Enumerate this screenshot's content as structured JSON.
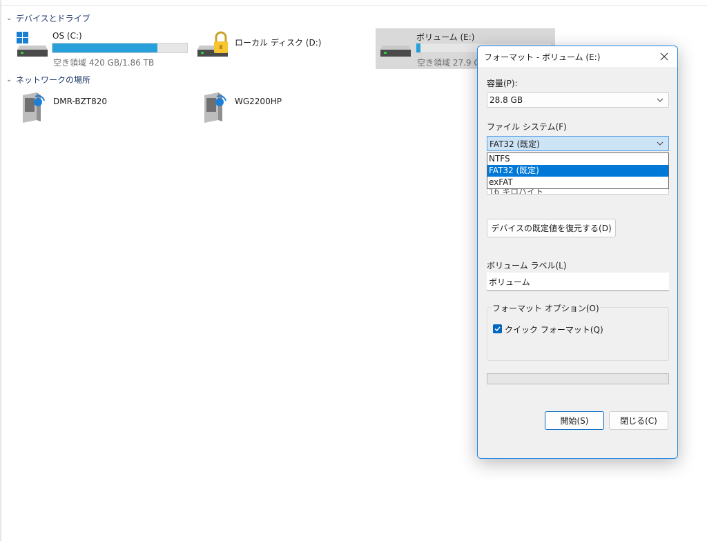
{
  "explorer": {
    "devices_section": "デバイスとドライブ",
    "network_section": "ネットワークの場所",
    "drives": [
      {
        "name": "OS (C:)",
        "free_text": "空き領域 420 GB/1.86 TB",
        "used_fraction": 0.78,
        "icon": "windows-drive-icon"
      },
      {
        "name": "ローカル ディスク (D:)",
        "icon": "locked-drive-icon"
      },
      {
        "name": "ボリューム (E:)",
        "free_text": "空き領域 27.9 G",
        "used_fraction": 0.03,
        "icon": "usb-drive-icon"
      }
    ],
    "network": [
      {
        "name": "DMR-BZT820",
        "icon": "network-device-icon"
      },
      {
        "name": "WG2200HP",
        "icon": "network-device-icon"
      }
    ]
  },
  "dialog": {
    "title": "フォーマット - ボリューム (E:)",
    "capacity_label": "容量(P):",
    "capacity_value": "28.8 GB",
    "filesystem_label": "ファイル システム(F)",
    "filesystem_value": "FAT32 (既定)",
    "filesystem_options": [
      "NTFS",
      "FAT32 (既定)",
      "exFAT"
    ],
    "filesystem_selected_index": 1,
    "allocation_partial": "16 キロバイト",
    "restore_defaults_button": "デバイスの既定値を復元する(D)",
    "volume_label_label": "ボリューム ラベル(L)",
    "volume_label_value": "ボリューム",
    "format_options_legend": "フォーマット オプション(O)",
    "quick_format_label": "クイック フォーマット(Q)",
    "quick_format_checked": true,
    "progress": 0,
    "start_button": "開始(S)",
    "close_button": "閉じる(C)"
  },
  "colors": {
    "accent": "#0078d7",
    "bar_fill": "#26a0da",
    "dialog_border": "#1e88e5",
    "section_header": "#1f3a6b"
  }
}
